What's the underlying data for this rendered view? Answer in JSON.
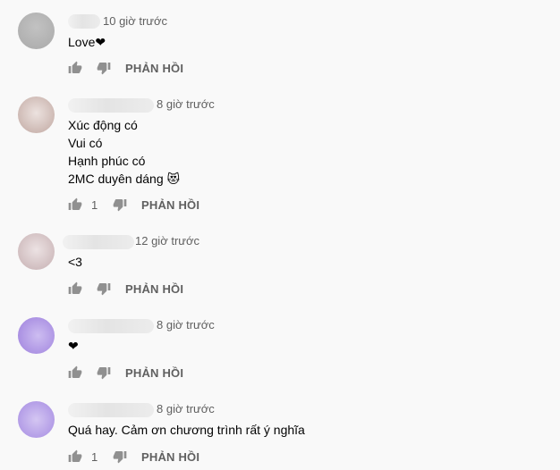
{
  "comments": [
    {
      "time": "10 giờ trước",
      "lines": [
        "Love❤"
      ],
      "like_count": "",
      "reply_label": "PHẢN HỒI"
    },
    {
      "time": "8 giờ trước",
      "lines": [
        "Xúc động có",
        "Vui có",
        "Hạnh phúc có",
        "2MC duyên dáng 😻"
      ],
      "like_count": "1",
      "reply_label": "PHẢN HỒI"
    },
    {
      "time": "12 giờ trước",
      "lines": [
        "<3"
      ],
      "like_count": "",
      "reply_label": "PHẢN HỒI"
    },
    {
      "time": "8 giờ trước",
      "lines": [
        "❤"
      ],
      "like_count": "",
      "reply_label": "PHẢN HỒI"
    },
    {
      "time": "8 giờ trước",
      "lines": [
        "Quá hay. Cảm ơn chương trình rất ý nghĩa"
      ],
      "like_count": "1",
      "reply_label": "PHẢN HỒI"
    }
  ],
  "icons": {
    "like": "thumb-up-icon",
    "dislike": "thumb-down-icon"
  },
  "colors": {
    "background": "#f9f9f9",
    "secondary_text": "#606060",
    "primary_text": "#030303"
  }
}
